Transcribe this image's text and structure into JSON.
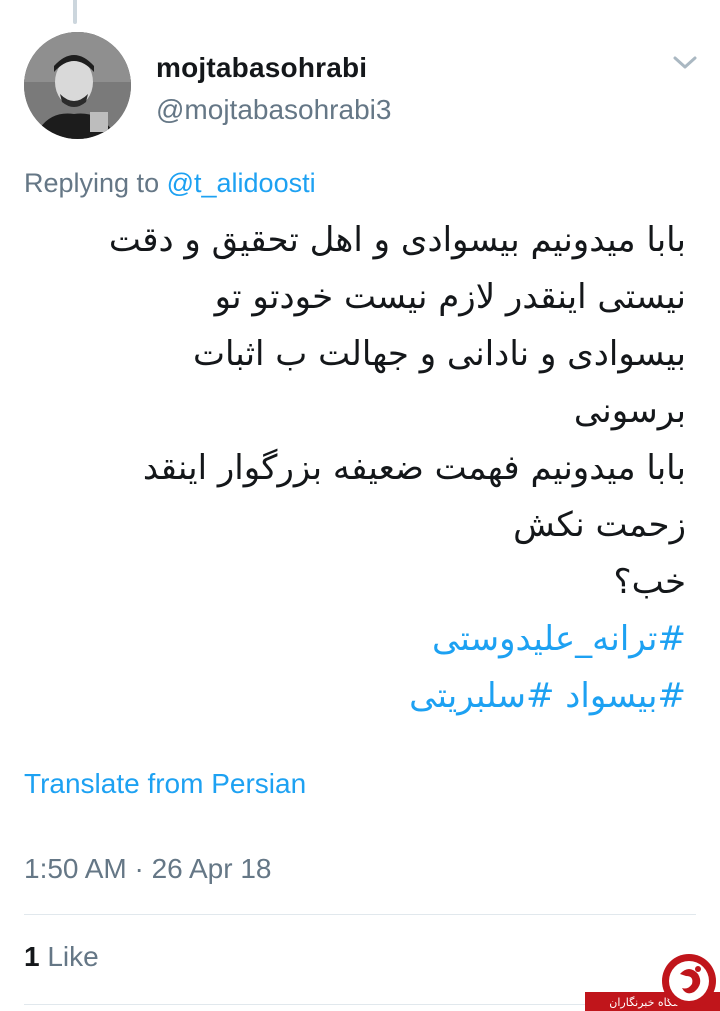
{
  "tweet": {
    "display_name": "mojtabasohrabi",
    "handle": "@mojtabasohrabi3",
    "replying_prefix": "Replying to ",
    "replying_to": "@t_alidoosti",
    "body_lines": [
      "بابا میدونیم بیسوادی و اهل تحقیق و دقت",
      "نیستی اینقدر لازم نیست خودتو تو",
      "بیسوادی و نادانی و جهالت ب اثبات",
      "برسونی",
      "بابا میدونیم فهمت ضعیفه بزرگوار اینقد",
      "زحمت نکش",
      "خب؟"
    ],
    "hashtag_lines": [
      "#ترانه_علیدوستی",
      "#بیسواد #سلبریتی"
    ],
    "translate_label": "Translate from Persian",
    "timestamp": "1:50 AM · 26 Apr 18",
    "like_count": "1",
    "like_label": " Like"
  },
  "watermark": {
    "text": "باشگاه خبرنگاران"
  },
  "icons": {
    "menu": "chevron-down-icon",
    "watermark": "watermark-logo-icon"
  },
  "colors": {
    "link": "#1da1f2",
    "text": "#14171a",
    "muted": "#657786",
    "divider": "#e1e8ed",
    "watermark_red": "#c0151b"
  }
}
